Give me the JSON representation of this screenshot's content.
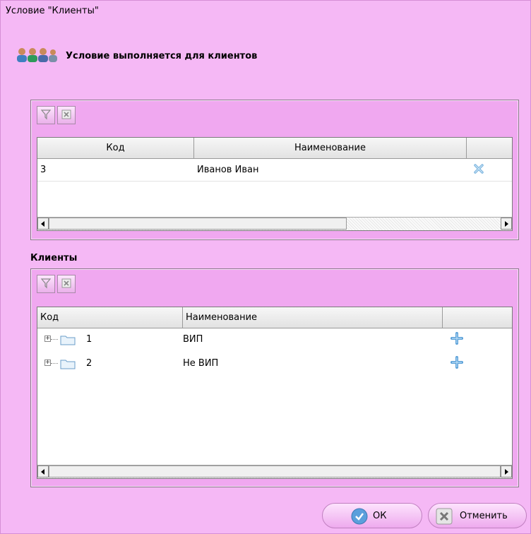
{
  "window": {
    "title": "Условие \"Клиенты\""
  },
  "header": {
    "text": "Условие выполняется для клиентов",
    "icon": "users-icon"
  },
  "selected": {
    "toolbar": {
      "filter_icon": "filter-icon",
      "clear_icon": "clear-filter-icon"
    },
    "columns": [
      "Код",
      "Наименование",
      ""
    ],
    "rows": [
      {
        "code": "3",
        "name": "Иванов Иван",
        "action_icon": "remove-icon"
      }
    ]
  },
  "clients": {
    "label": "Клиенты",
    "toolbar": {
      "filter_icon": "filter-icon",
      "clear_icon": "clear-filter-icon"
    },
    "columns": [
      "Код",
      "Наименование",
      ""
    ],
    "rows": [
      {
        "code": "1",
        "name": "ВИП",
        "expander": "+",
        "action_icon": "add-icon"
      },
      {
        "code": "2",
        "name": "Не ВИП",
        "expander": "+",
        "action_icon": "add-icon"
      }
    ]
  },
  "buttons": {
    "ok": "ОК",
    "cancel": "Отменить"
  }
}
